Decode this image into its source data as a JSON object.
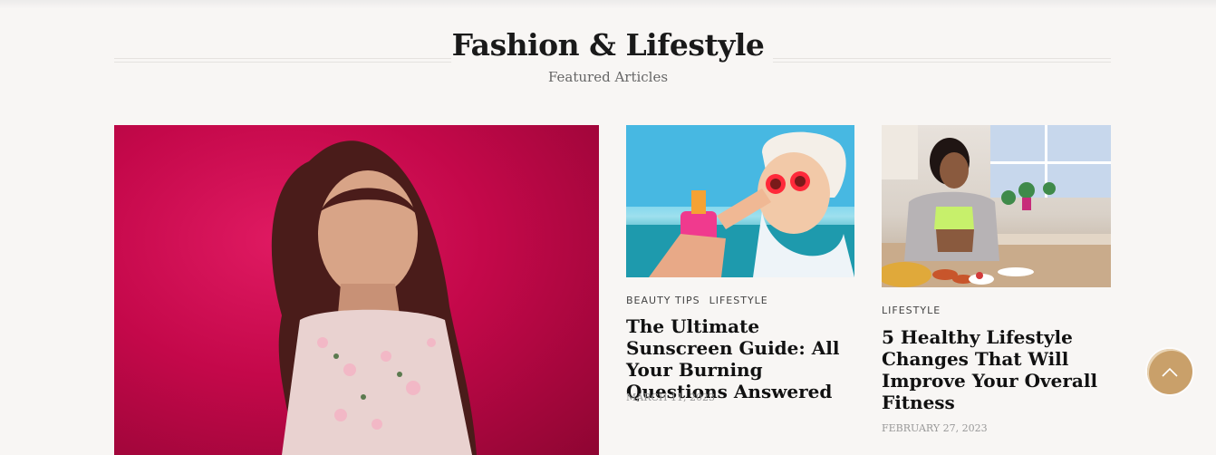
{
  "section": {
    "title": "Fashion & Lifestyle",
    "subtitle": "Featured Articles"
  },
  "articles": [
    {
      "image_icon": "woman-portrait-image",
      "categories": [
        "Beauty Tips",
        "Lifestyle"
      ],
      "title": "The Ultimate Sunscreen Guide: All Your Burning Questions Answered",
      "date": "March 11, 2023"
    },
    {
      "image_icon": "kitchen-fitness-image",
      "categories": [
        "Lifestyle"
      ],
      "title": "5 Healthy Lifestyle Changes That Will Improve Your Overall Fitness",
      "date": "February 27, 2023"
    }
  ],
  "scroll_top_icon": "chevron-up-icon",
  "colors": {
    "background": "#f8f6f4",
    "accent": "#c9a06a",
    "hero_bg": "#c4084a"
  }
}
